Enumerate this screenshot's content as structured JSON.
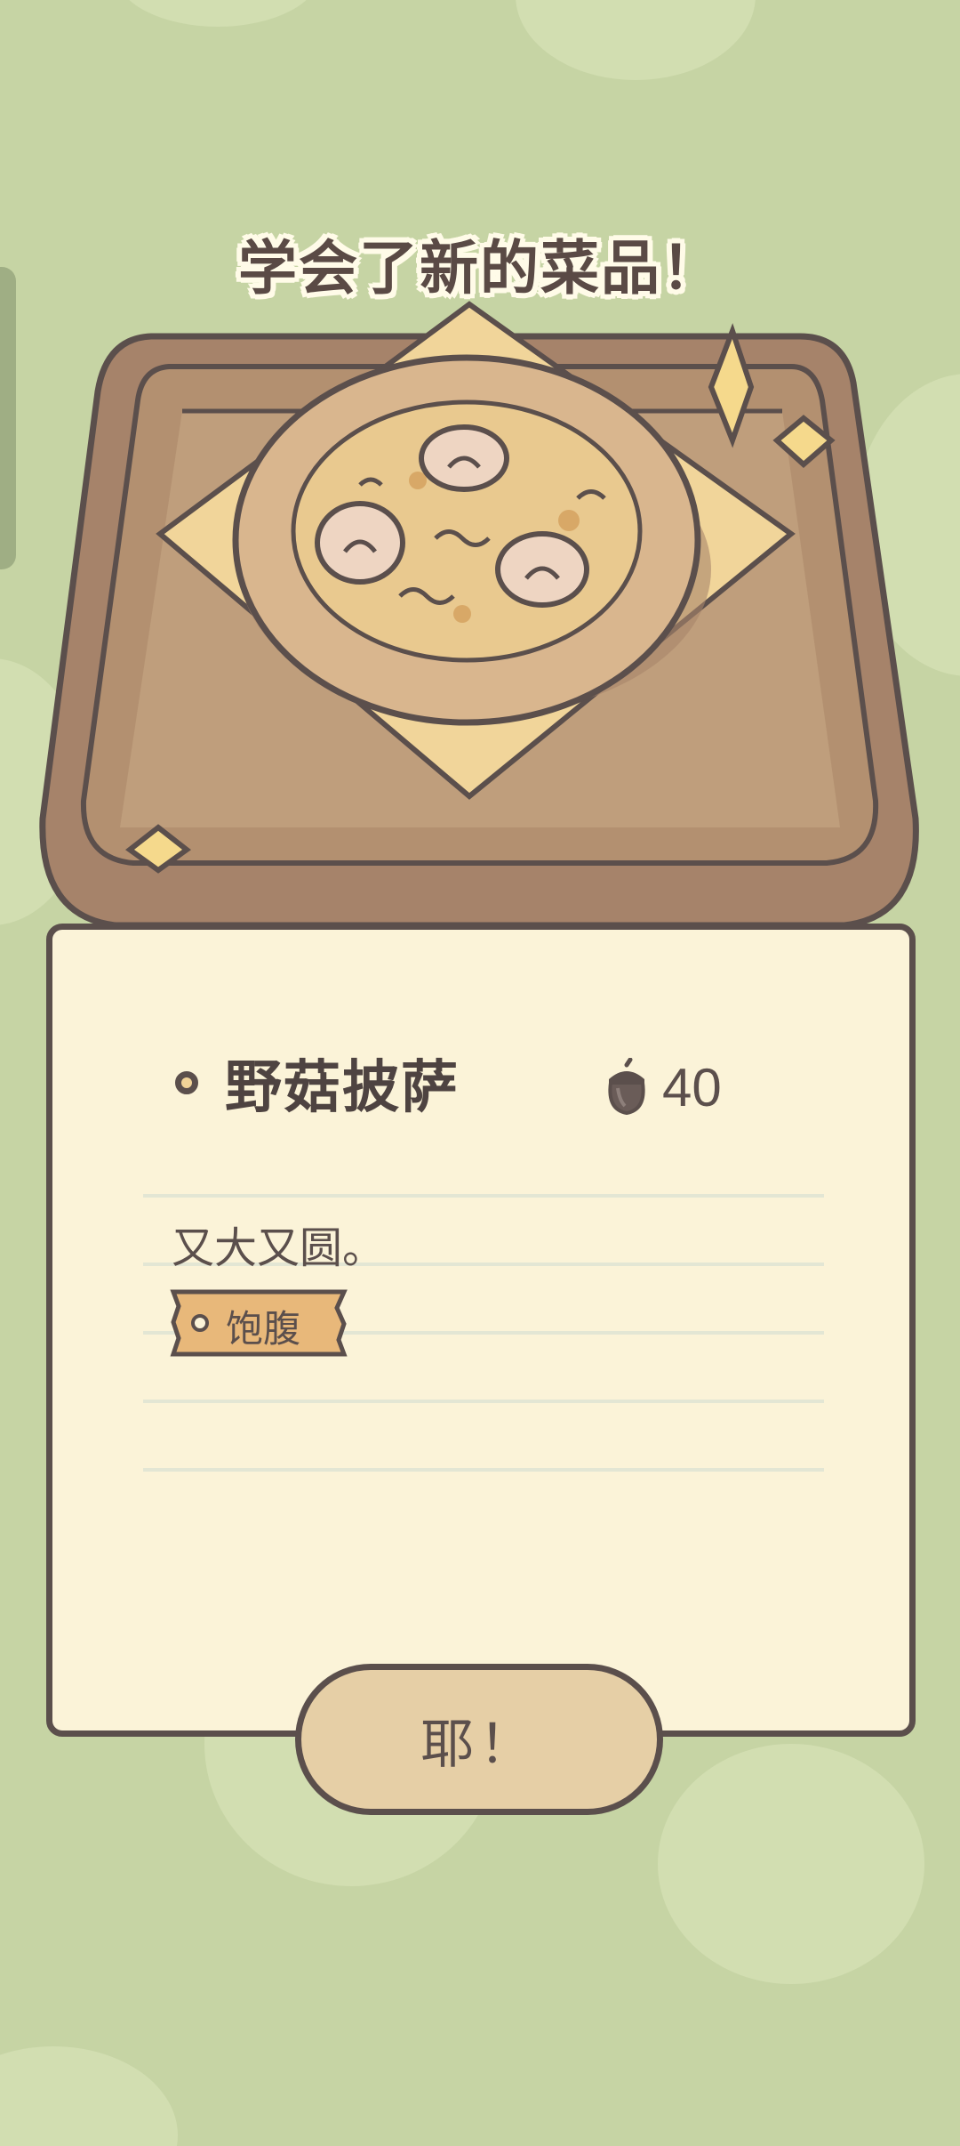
{
  "popup": {
    "title": "学会了新的菜品！",
    "dish_name": "野菇披萨",
    "price_icon": "acorn-icon",
    "price_value": "40",
    "description": "又大又圆。",
    "tag_label": "饱腹",
    "confirm_label": "耶！"
  },
  "colors": {
    "background": "#c6d4a4",
    "card": "#fbf3d8",
    "outline": "#5b4f4c",
    "button": "#e6cfa6",
    "tag": "#e8b87a",
    "tray": "#a6836a"
  }
}
